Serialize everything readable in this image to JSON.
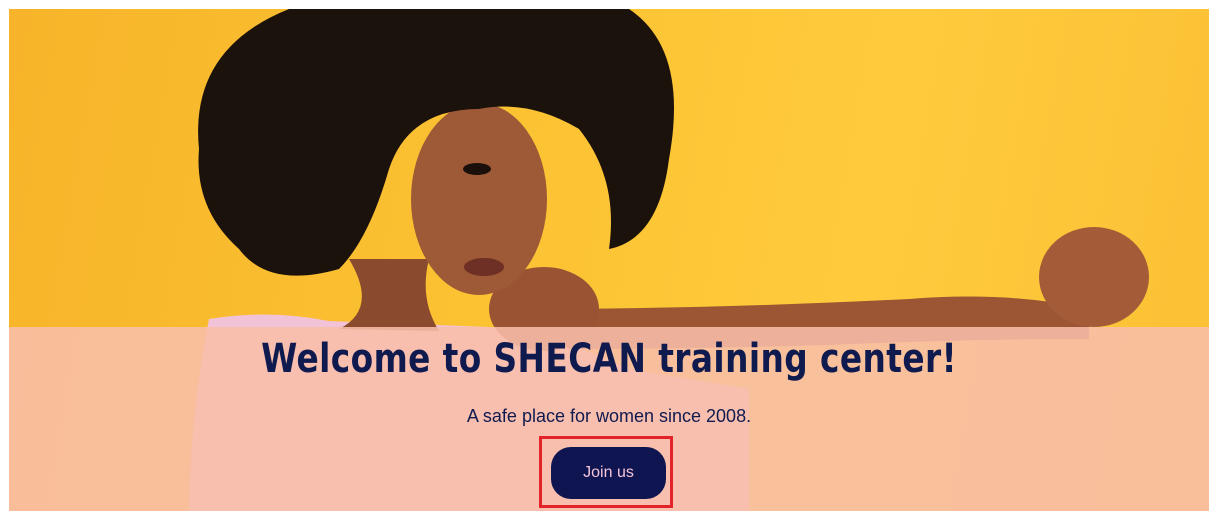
{
  "hero": {
    "headline": "Welcome to SHECAN training center!",
    "tagline": "A safe place for women since 2008.",
    "image": "woman-boxing-stance-photo",
    "background_color": "#fbc232",
    "banner_color": "#f8beaa"
  },
  "cta": {
    "join_label": "Join us",
    "button_color": "#0e1550",
    "button_text_color": "#f6c6d9",
    "highlight_color": "#e2232a"
  }
}
